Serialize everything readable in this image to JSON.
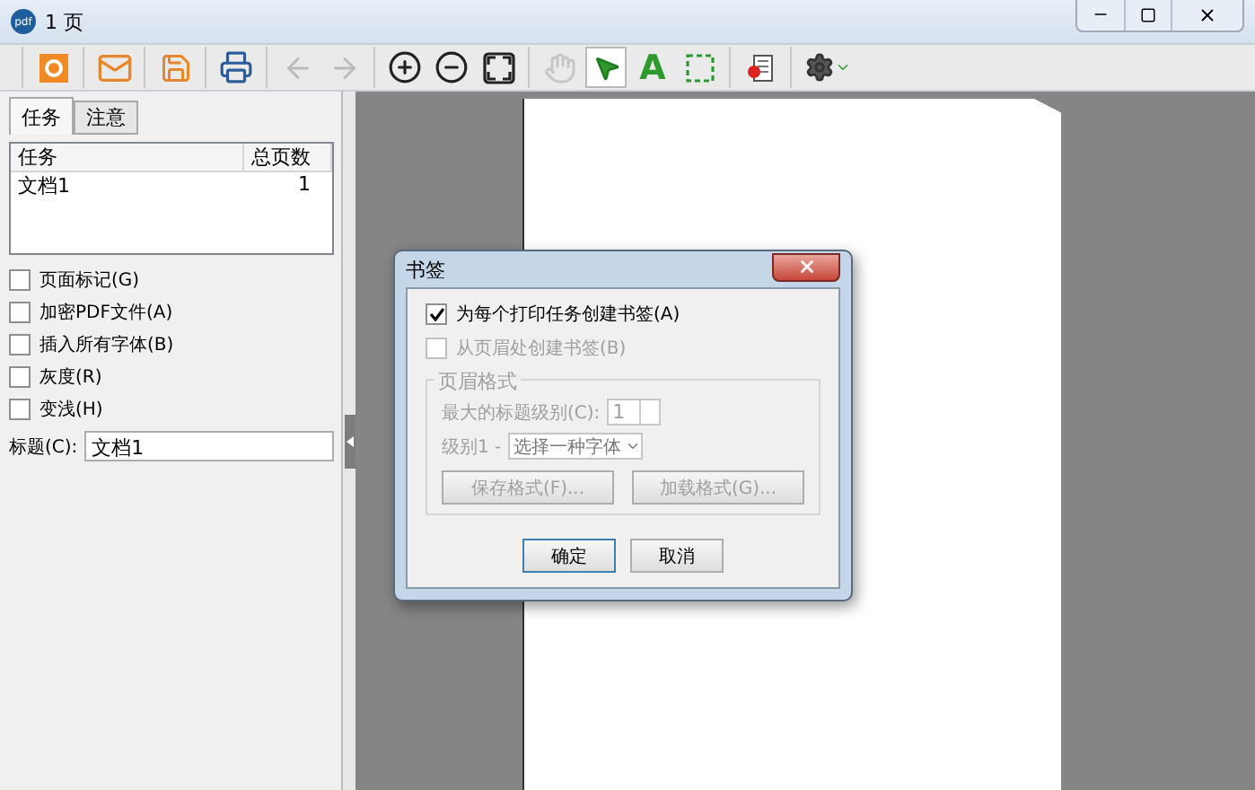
{
  "window": {
    "logo": "pdf",
    "title": "1 页"
  },
  "toolbar": {
    "groups": [
      [
        {
          "kind": "button",
          "disabled": false,
          "selected": false
        }
      ],
      [
        {
          "kind": "button",
          "disabled": false,
          "selected": false
        }
      ],
      [
        {
          "kind": "button",
          "disabled": false,
          "selected": false
        }
      ],
      [
        {
          "kind": "button",
          "disabled": false,
          "selected": false
        }
      ],
      [
        {
          "kind": "button",
          "disabled": true,
          "selected": false
        },
        {
          "kind": "button",
          "disabled": true,
          "selected": false
        }
      ],
      [
        {
          "kind": "button",
          "disabled": false,
          "selected": false
        },
        {
          "kind": "button",
          "disabled": false,
          "selected": false
        },
        {
          "kind": "button",
          "disabled": false,
          "selected": false
        }
      ],
      [
        {
          "kind": "button",
          "disabled": true,
          "selected": false
        },
        {
          "kind": "button",
          "disabled": false,
          "selected": true
        },
        {
          "kind": "text",
          "label": "A",
          "disabled": false,
          "selected": false
        },
        {
          "kind": "button",
          "disabled": false,
          "selected": false
        }
      ],
      [
        {
          "kind": "button",
          "disabled": false,
          "selected": false
        }
      ],
      [
        {
          "kind": "menu",
          "disabled": false,
          "selected": false
        }
      ]
    ]
  },
  "left_panel": {
    "tabs": [
      {
        "label": "任务",
        "selected": true
      },
      {
        "label": "注意",
        "selected": false
      }
    ],
    "table": {
      "columns": [
        "任务",
        "总页数"
      ],
      "rows": [
        {
          "cells": [
            "文档1",
            "1"
          ]
        }
      ]
    },
    "options": [
      {
        "label": "页面标记(G)",
        "checked": false
      },
      {
        "label": "加密PDF文件(A)",
        "checked": false
      },
      {
        "label": "插入所有字体(B)",
        "checked": false
      },
      {
        "label": "灰度(R)",
        "checked": false
      },
      {
        "label": "变浅(H)",
        "checked": false
      }
    ],
    "title_field": {
      "label": "标题(C):",
      "value": "文档1"
    }
  },
  "dialog": {
    "title": "书签",
    "checkboxes": [
      {
        "label": "为每个打印任务创建书签(A)",
        "checked": true,
        "disabled": false
      },
      {
        "label": "从页眉处创建书签(B)",
        "checked": false,
        "disabled": true
      }
    ],
    "group": {
      "legend": "页眉格式",
      "disabled": true,
      "max_level": {
        "label": "最大的标题级别(C):",
        "value": "1"
      },
      "font": {
        "label": "级别1 -",
        "value": "选择一种字体"
      },
      "buttons": [
        "保存格式(F)...",
        "加载格式(G)..."
      ]
    },
    "buttons": [
      "确定",
      "取消"
    ]
  }
}
